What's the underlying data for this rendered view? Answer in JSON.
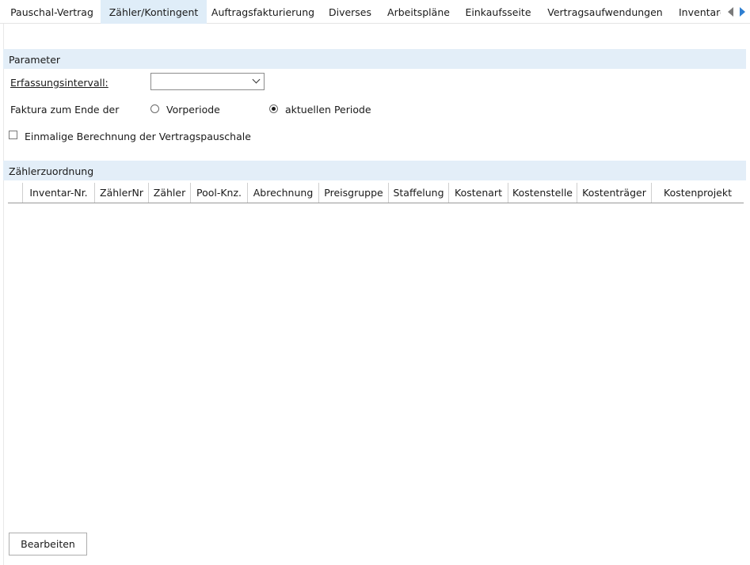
{
  "tabs": [
    {
      "label": "Pauschal-Vertrag",
      "active": false
    },
    {
      "label": "Zähler/Kontingent",
      "active": true
    },
    {
      "label": "Auftragsfakturierung",
      "active": false
    },
    {
      "label": "Diverses",
      "active": false
    },
    {
      "label": "Arbeitspläne",
      "active": false
    },
    {
      "label": "Einkaufsseite",
      "active": false
    },
    {
      "label": "Vertragsaufwendungen",
      "active": false
    },
    {
      "label": "Inventare",
      "active": false
    }
  ],
  "parameter": {
    "header": "Parameter",
    "interval_label": "Erfassungsintervall:",
    "interval_value": "",
    "billing_label": "Faktura zum Ende der",
    "billing_options": [
      {
        "label": "Vorperiode",
        "checked": false
      },
      {
        "label": "aktuellen Periode",
        "checked": true
      }
    ],
    "onetime_label": "Einmalige Berechnung der Vertragspauschale",
    "onetime_checked": false
  },
  "assignment": {
    "header": "Zählerzuordnung",
    "columns": [
      "",
      "Inventar-Nr.",
      "ZählerNr",
      "Zähler",
      "Pool-Knz.",
      "Abrechnung",
      "Preisgruppe",
      "Staffelung",
      "Kostenart",
      "Kostenstelle",
      "Kostenträger",
      "Kostenprojekt"
    ],
    "rows": []
  },
  "footer": {
    "edit_label": "Bearbeiten"
  },
  "icons": {
    "scroll_left": "triangle-left-icon",
    "scroll_right": "triangle-right-icon",
    "dropdown": "chevron-down-icon"
  },
  "colors": {
    "active_tab": "#dfedf8",
    "section_header": "#e3eef8",
    "scroll_right_arrow": "#2f7fd1"
  }
}
